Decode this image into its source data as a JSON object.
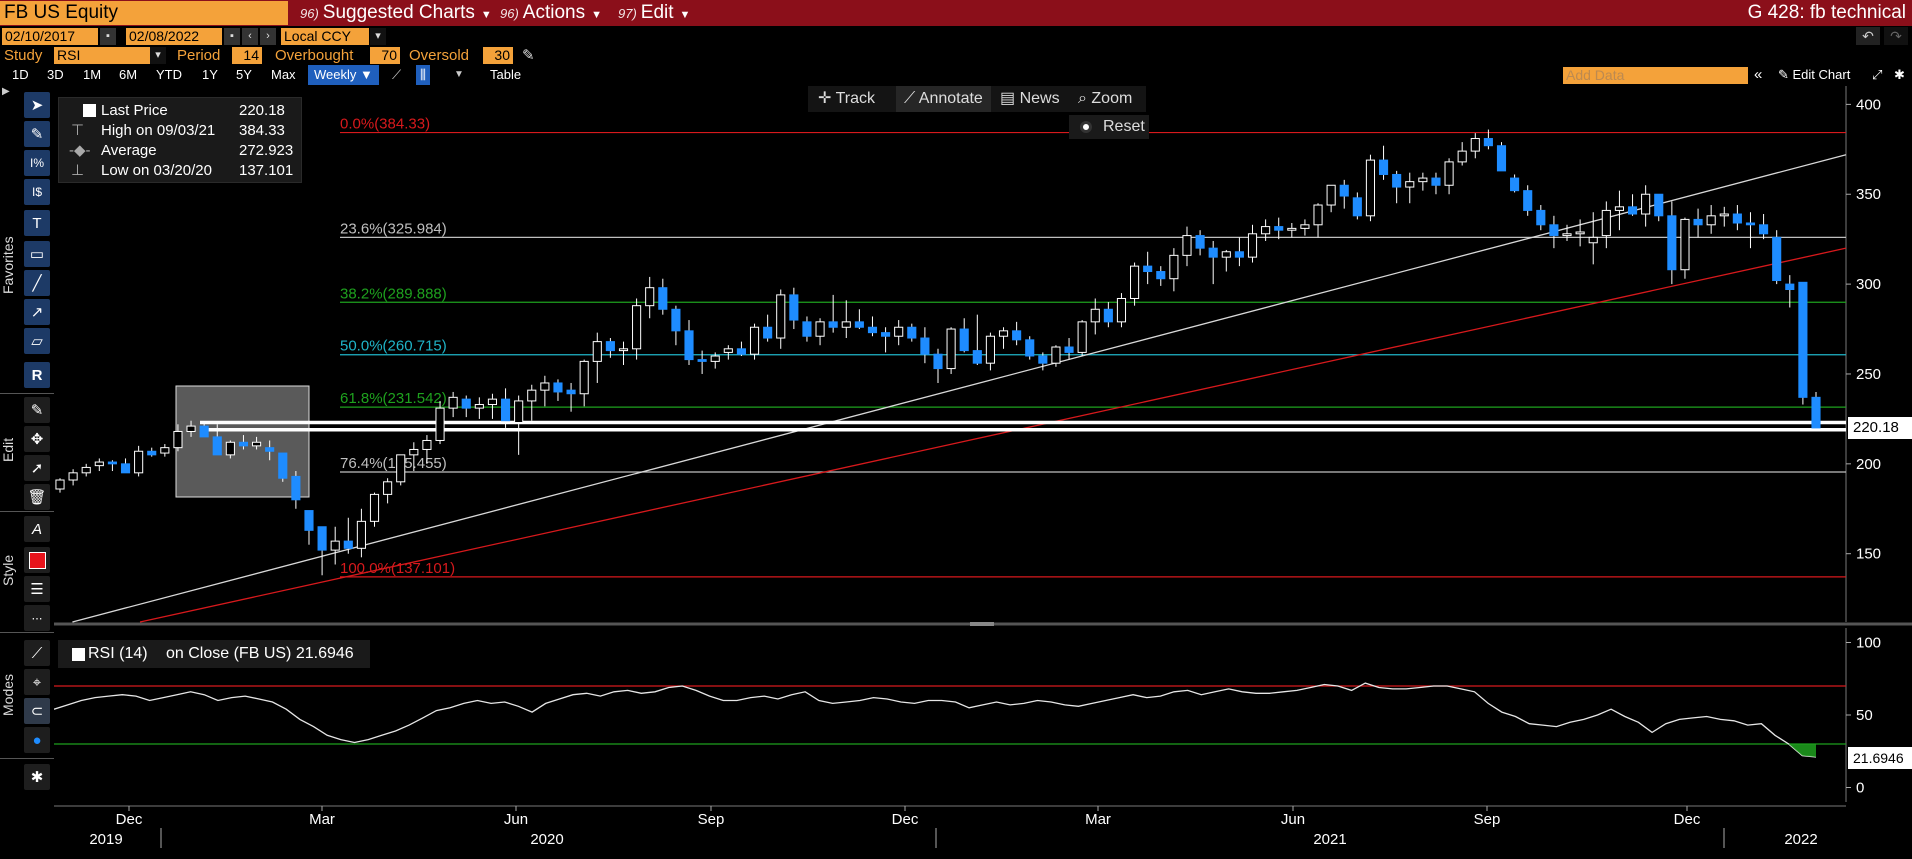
{
  "topbar": {
    "ticker": "FB US Equity",
    "menus": [
      {
        "num": "96)",
        "label": "Suggested Charts"
      },
      {
        "num": "96)",
        "label": "Actions"
      },
      {
        "num": "97)",
        "label": "Edit"
      }
    ],
    "function_title": "G 428: fb technical"
  },
  "daterow": {
    "start_date": "02/10/2017",
    "end_date": "02/08/2022",
    "currency": "Local CCY"
  },
  "studyrow": {
    "study_label": "Study",
    "study_value": "RSI",
    "period_label": "Period",
    "period_value": "14",
    "overbought_label": "Overbought",
    "overbought_value": "70",
    "oversold_label": "Oversold",
    "oversold_value": "30"
  },
  "periodrow": {
    "periods": [
      "1D",
      "3D",
      "1M",
      "6M",
      "YTD",
      "1Y",
      "5Y",
      "Max"
    ],
    "frequency": "Weekly",
    "table_label": "Table",
    "add_data_placeholder": "Add Data",
    "edit_chart_label": "Edit Chart"
  },
  "left_toolbar": {
    "sections": [
      "Favorites",
      "Edit",
      "Style",
      "Modes"
    ],
    "style_color": "#e8131b"
  },
  "chart_toolbar": {
    "track": "Track",
    "annotate": "Annotate",
    "news": "News",
    "zoom": "Zoom",
    "reset": "Reset"
  },
  "legend": {
    "rows": [
      {
        "label": "Last Price",
        "value": "220.18"
      },
      {
        "label": "High on 09/03/21",
        "value": "384.33"
      },
      {
        "label": "Average",
        "value": "272.923"
      },
      {
        "label": "Low on 03/20/20",
        "value": "137.101"
      }
    ]
  },
  "rsi_legend": {
    "label": "RSI (14)",
    "suffix": "on Close (FB US)",
    "value": "21.6946"
  },
  "colors": {
    "up_candle": "#ffffff",
    "down_candle": "#1e8cff",
    "fib_red": "#d7191c",
    "fib_grey": "#bfbfbf",
    "fib_green": "#1ea11e",
    "fib_cyan": "#1fb4c8",
    "trend_white": "#d8d8d8",
    "trend_red": "#d7191c",
    "ticker_bg": "#f4a23a",
    "topbar_bg": "#8b0f1a"
  },
  "chart_data": [
    {
      "type": "candlestick",
      "y_axis_ticks": [
        150,
        200,
        250,
        300,
        350,
        400
      ],
      "ylim": [
        112,
        408
      ],
      "last_price_tag": "220.18",
      "x_ticks": [
        "Dec",
        "Mar",
        "Jun",
        "Sep",
        "Dec",
        "Mar",
        "Jun",
        "Sep",
        "Dec"
      ],
      "x_years": [
        "2019",
        "2020",
        "2021",
        "2022"
      ],
      "fib_levels": [
        {
          "label": "0.0%(384.33)",
          "value": 384.33,
          "color": "red"
        },
        {
          "label": "23.6%(325.984)",
          "value": 325.984,
          "color": "grey"
        },
        {
          "label": "38.2%(289.888)",
          "value": 289.888,
          "color": "green"
        },
        {
          "label": "50.0%(260.715)",
          "value": 260.715,
          "color": "cyan"
        },
        {
          "label": "61.8%(231.542)",
          "value": 231.542,
          "color": "green"
        },
        {
          "label": "76.4%(195.455)",
          "value": 195.455,
          "color": "grey"
        },
        {
          "label": "100.0%(137.101)",
          "value": 137.101,
          "color": "red"
        }
      ],
      "support_lines": [
        223,
        219
      ],
      "candles": [
        [
          186,
          192,
          184,
          191
        ],
        [
          191,
          197,
          188,
          195
        ],
        [
          195,
          200,
          193,
          198
        ],
        [
          199,
          203,
          196,
          201
        ],
        [
          201,
          202,
          196,
          200
        ],
        [
          200,
          203,
          195,
          195
        ],
        [
          195,
          210,
          193,
          207
        ],
        [
          207,
          209,
          204,
          205
        ],
        [
          206,
          211,
          204,
          209
        ],
        [
          209,
          222,
          207,
          218
        ],
        [
          218,
          224,
          215,
          221
        ],
        [
          221,
          223,
          215,
          215
        ],
        [
          215,
          222,
          205,
          205
        ],
        [
          205,
          213,
          203,
          212
        ],
        [
          212,
          216,
          208,
          210
        ],
        [
          210,
          215,
          208,
          212
        ],
        [
          209,
          213,
          202,
          207
        ],
        [
          206,
          206,
          190,
          192
        ],
        [
          193,
          196,
          175,
          180
        ],
        [
          174,
          174,
          155,
          163
        ],
        [
          165,
          165,
          138,
          152
        ],
        [
          152,
          165,
          144,
          157
        ],
        [
          157,
          170,
          150,
          153
        ],
        [
          153,
          175,
          148,
          168
        ],
        [
          168,
          184,
          165,
          183
        ],
        [
          183,
          192,
          178,
          190
        ],
        [
          190,
          205,
          188,
          205
        ],
        [
          205,
          212,
          196,
          208
        ],
        [
          208,
          216,
          200,
          213
        ],
        [
          213,
          235,
          211,
          231
        ],
        [
          231,
          240,
          226,
          237
        ],
        [
          236,
          238,
          226,
          231
        ],
        [
          231,
          237,
          225,
          233
        ],
        [
          233,
          239,
          225,
          236
        ],
        [
          236,
          242,
          220,
          224
        ],
        [
          223,
          238,
          205,
          235
        ],
        [
          235,
          244,
          224,
          241
        ],
        [
          241,
          249,
          232,
          245
        ],
        [
          245,
          247,
          235,
          240
        ],
        [
          241,
          245,
          229,
          239
        ],
        [
          239,
          258,
          232,
          257
        ],
        [
          257,
          273,
          245,
          268
        ],
        [
          268,
          270,
          259,
          263
        ],
        [
          263,
          268,
          255,
          264
        ],
        [
          264,
          292,
          258,
          288
        ],
        [
          288,
          304,
          281,
          298
        ],
        [
          298,
          303,
          283,
          286
        ],
        [
          286,
          288,
          266,
          274
        ],
        [
          274,
          280,
          255,
          258
        ],
        [
          258,
          263,
          250,
          257
        ],
        [
          257,
          262,
          253,
          260
        ],
        [
          262,
          266,
          258,
          264
        ],
        [
          264,
          268,
          260,
          261
        ],
        [
          261,
          278,
          258,
          276
        ],
        [
          276,
          283,
          268,
          270
        ],
        [
          270,
          297,
          264,
          294
        ],
        [
          294,
          298,
          275,
          280
        ],
        [
          279,
          282,
          268,
          271
        ],
        [
          271,
          281,
          266,
          279
        ],
        [
          279,
          294,
          273,
          276
        ],
        [
          276,
          291,
          270,
          279
        ],
        [
          279,
          286,
          275,
          276
        ],
        [
          276,
          282,
          271,
          273
        ],
        [
          273,
          276,
          262,
          271
        ],
        [
          271,
          280,
          266,
          276
        ],
        [
          276,
          278,
          268,
          270
        ],
        [
          270,
          276,
          256,
          261
        ],
        [
          261,
          264,
          245,
          253
        ],
        [
          253,
          276,
          250,
          275
        ],
        [
          275,
          281,
          262,
          263
        ],
        [
          263,
          283,
          255,
          256
        ],
        [
          256,
          273,
          252,
          271
        ],
        [
          271,
          276,
          264,
          274
        ],
        [
          274,
          279,
          266,
          269
        ],
        [
          269,
          271,
          258,
          260
        ],
        [
          260,
          262,
          252,
          256
        ],
        [
          256,
          266,
          254,
          265
        ],
        [
          265,
          270,
          258,
          262
        ],
        [
          262,
          280,
          260,
          279
        ],
        [
          279,
          292,
          272,
          286
        ],
        [
          286,
          290,
          276,
          279
        ],
        [
          279,
          295,
          276,
          292
        ],
        [
          292,
          312,
          288,
          310
        ],
        [
          310,
          318,
          300,
          307
        ],
        [
          307,
          310,
          299,
          303
        ],
        [
          303,
          320,
          296,
          316
        ],
        [
          316,
          332,
          310,
          327
        ],
        [
          327,
          330,
          316,
          320
        ],
        [
          320,
          324,
          300,
          315
        ],
        [
          315,
          319,
          307,
          318
        ],
        [
          318,
          326,
          310,
          315
        ],
        [
          315,
          333,
          312,
          328
        ],
        [
          328,
          336,
          324,
          332
        ],
        [
          332,
          337,
          325,
          330
        ],
        [
          330,
          334,
          326,
          331
        ],
        [
          331,
          336,
          327,
          333
        ],
        [
          333,
          345,
          326,
          344
        ],
        [
          344,
          355,
          340,
          355
        ],
        [
          355,
          358,
          342,
          349
        ],
        [
          348,
          351,
          336,
          338
        ],
        [
          338,
          372,
          335,
          369
        ],
        [
          369,
          377,
          358,
          361
        ],
        [
          361,
          363,
          345,
          354
        ],
        [
          354,
          362,
          345,
          357
        ],
        [
          357,
          362,
          352,
          359
        ],
        [
          359,
          362,
          350,
          355
        ],
        [
          355,
          370,
          350,
          368
        ],
        [
          368,
          379,
          366,
          374
        ],
        [
          374,
          384,
          370,
          381
        ],
        [
          381,
          386,
          375,
          377
        ],
        [
          377,
          379,
          363,
          363
        ],
        [
          359,
          361,
          351,
          352
        ],
        [
          352,
          355,
          338,
          341
        ],
        [
          341,
          344,
          330,
          333
        ],
        [
          333,
          338,
          320,
          327
        ],
        [
          327,
          333,
          324,
          328
        ],
        [
          328,
          336,
          321,
          329
        ],
        [
          323,
          340,
          311,
          326
        ],
        [
          327,
          346,
          320,
          341
        ],
        [
          341,
          352,
          330,
          343
        ],
        [
          343,
          350,
          338,
          339
        ],
        [
          339,
          355,
          332,
          350
        ],
        [
          350,
          350,
          335,
          338
        ],
        [
          338,
          346,
          300,
          308
        ],
        [
          308,
          337,
          303,
          336
        ],
        [
          336,
          342,
          326,
          333
        ],
        [
          333,
          344,
          328,
          338
        ],
        [
          338,
          343,
          332,
          339
        ],
        [
          339,
          344,
          330,
          334
        ],
        [
          334,
          340,
          320,
          333
        ],
        [
          333,
          339,
          325,
          328
        ],
        [
          326,
          330,
          300,
          302
        ],
        [
          300,
          305,
          287,
          297
        ],
        [
          301,
          301,
          233,
          237
        ],
        [
          237,
          240,
          218,
          220
        ]
      ]
    },
    {
      "type": "line",
      "name": "RSI (14)",
      "y_axis_ticks": [
        0,
        50,
        100
      ],
      "ylim": [
        -10,
        110
      ],
      "overbought": 70,
      "oversold": 30,
      "last_value": "21.6946",
      "values": [
        54,
        57,
        60,
        62,
        63,
        64,
        63,
        60,
        62,
        64,
        66,
        64,
        60,
        62,
        63,
        61,
        59,
        54,
        47,
        42,
        36,
        33,
        31,
        33,
        36,
        39,
        43,
        48,
        53,
        55,
        58,
        60,
        58,
        59,
        56,
        52,
        58,
        61,
        64,
        65,
        63,
        66,
        67,
        65,
        66,
        69,
        70,
        67,
        63,
        60,
        60,
        62,
        63,
        61,
        64,
        66,
        60,
        58,
        59,
        60,
        62,
        61,
        59,
        58,
        60,
        60,
        59,
        55,
        57,
        59,
        57,
        58,
        60,
        59,
        57,
        56,
        58,
        60,
        62,
        64,
        62,
        63,
        66,
        67,
        64,
        66,
        68,
        66,
        65,
        65,
        66,
        67,
        69,
        71,
        70,
        67,
        72,
        69,
        68,
        68,
        69,
        70,
        70,
        68,
        66,
        58,
        52,
        49,
        44,
        43,
        42,
        45,
        47,
        50,
        54,
        49,
        45,
        38,
        44,
        47,
        48,
        49,
        47,
        46,
        43,
        44,
        36,
        30,
        22,
        21
      ]
    }
  ]
}
